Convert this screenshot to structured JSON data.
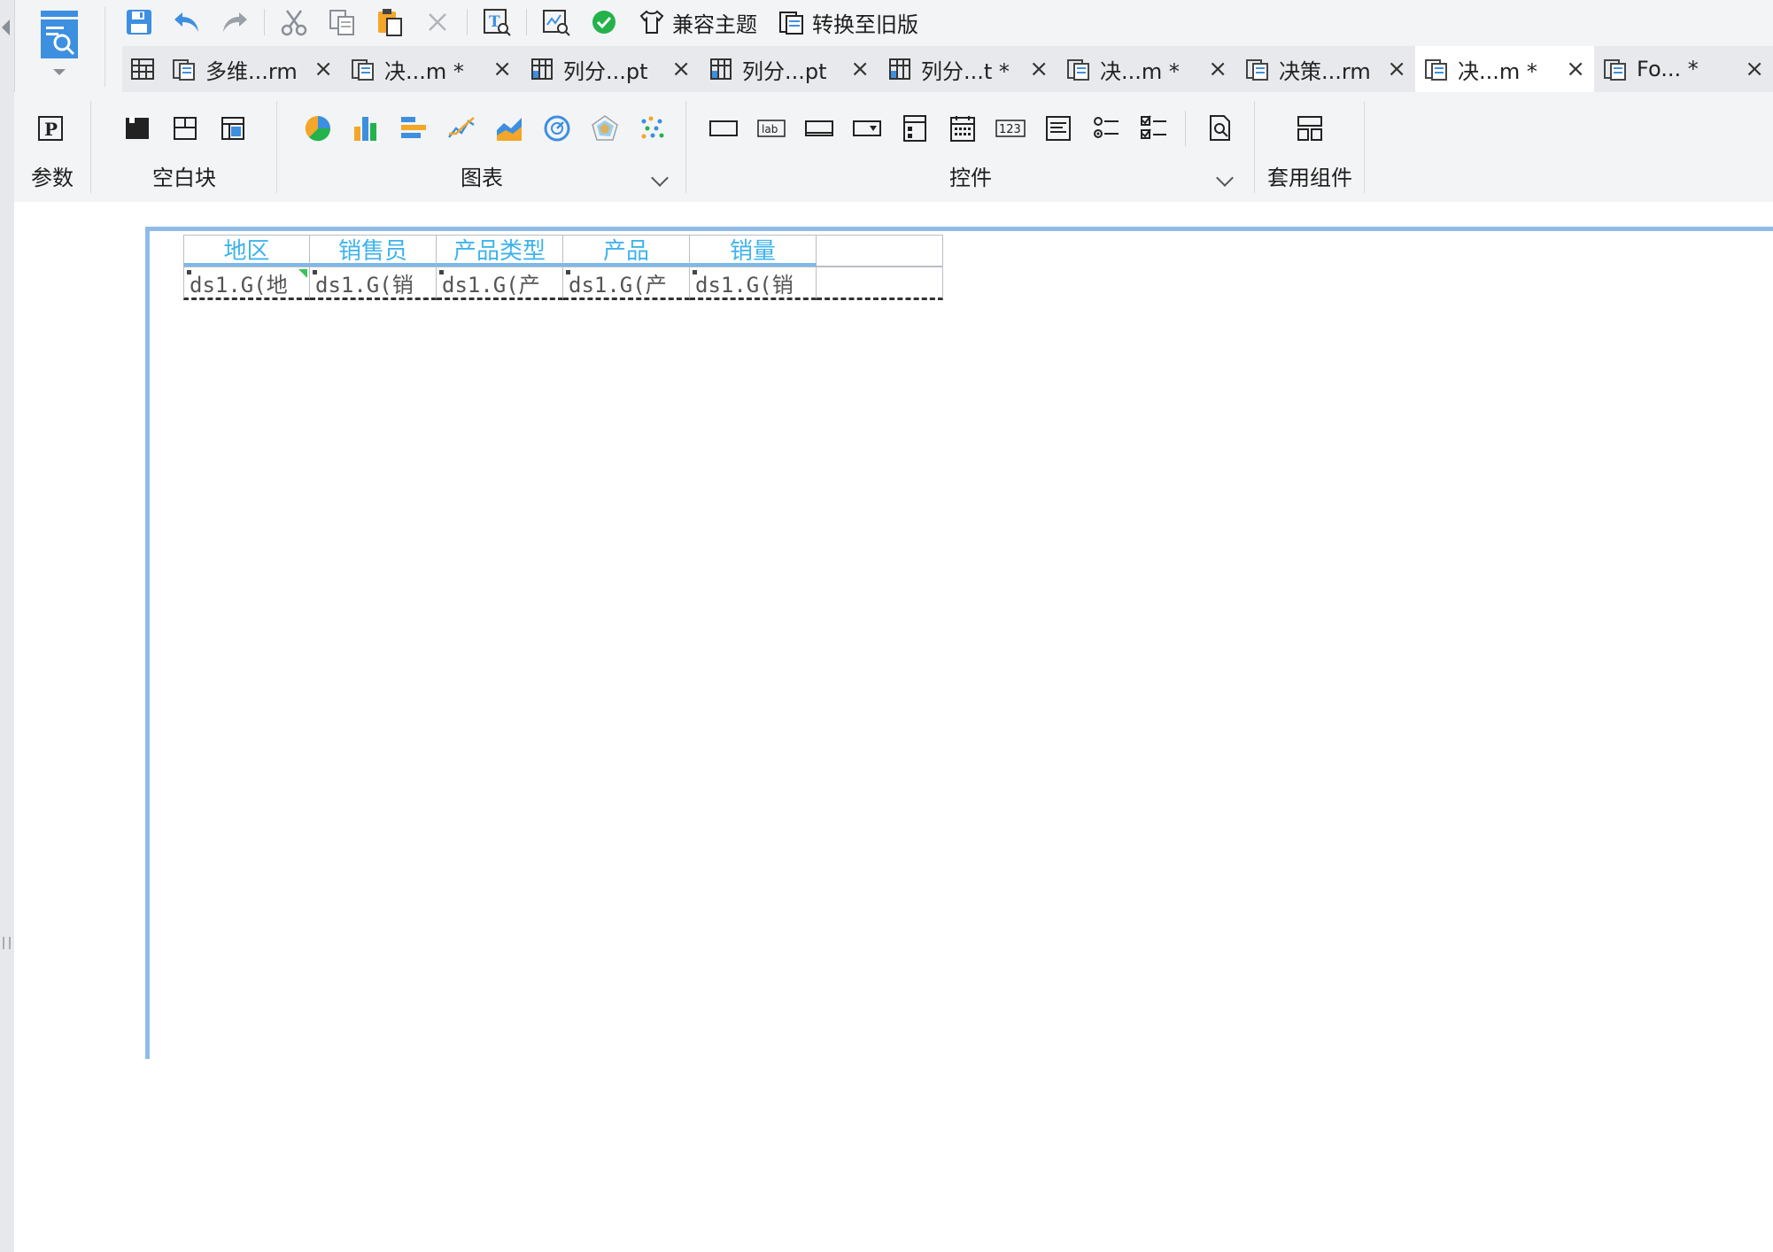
{
  "toolbar": {
    "icons": [
      "save-icon",
      "undo-icon",
      "redo-icon",
      "cut-icon",
      "copy-icon",
      "paste-icon",
      "delete-icon",
      "text-search-icon",
      "preview-chart-icon",
      "check-icon"
    ],
    "compat_theme_label": "兼容主题",
    "convert_old_label": "转换至旧版"
  },
  "tabs": [
    {
      "label": "多维...rm",
      "icon": "form-icon",
      "active": false
    },
    {
      "label": "决...m *",
      "icon": "form-icon",
      "active": false
    },
    {
      "label": "列分...pt",
      "icon": "report-icon",
      "active": false
    },
    {
      "label": "列分...pt",
      "icon": "report-icon",
      "active": false
    },
    {
      "label": "列分...t *",
      "icon": "report-icon",
      "active": false
    },
    {
      "label": "决...m *",
      "icon": "form-icon",
      "active": false
    },
    {
      "label": "决策...rm",
      "icon": "form-icon",
      "active": false
    },
    {
      "label": "决...m *",
      "icon": "form-icon",
      "active": true
    },
    {
      "label": "Fo... *",
      "icon": "form-icon",
      "active": false
    }
  ],
  "tab_close": "×",
  "ribbon": {
    "param_label": "参数",
    "blank_label": "空白块",
    "chart_label": "图表",
    "control_label": "控件",
    "widget_label": "套用组件"
  },
  "report": {
    "headers": [
      "地区",
      "销售员",
      "产品类型",
      "产品",
      "销量",
      ""
    ],
    "cells": [
      "ds1.G(地",
      "ds1.G(销",
      "ds1.G(产",
      "ds1.G(产",
      "ds1.G(销",
      ""
    ]
  },
  "colors": {
    "accent": "#3d8fe0",
    "header_text": "#3fb3ec",
    "frame": "#8fbbe8",
    "check": "#24b24b",
    "selection": "#39c25b"
  }
}
